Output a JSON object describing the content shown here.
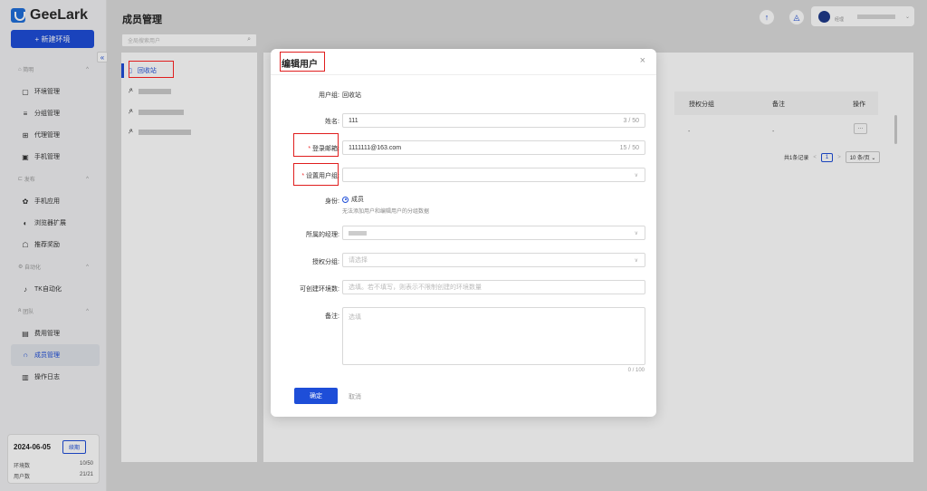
{
  "app": {
    "logo_text": "GeeLark",
    "new_env_label": "+ 新建环境",
    "collapse_label": "«"
  },
  "sidebar": {
    "sections": [
      {
        "label": "简明",
        "items": [
          {
            "label": "环境管理",
            "icon": "▢"
          },
          {
            "label": "分组管理",
            "icon": "≡"
          },
          {
            "label": "代理管理",
            "icon": "⊞"
          },
          {
            "label": "手机管理",
            "icon": "▣"
          }
        ]
      },
      {
        "label": "发布",
        "items": [
          {
            "label": "手机应用",
            "icon": "✿"
          },
          {
            "label": "浏览器扩展",
            "icon": "◐"
          },
          {
            "label": "推荐奖励",
            "icon": "☖"
          }
        ]
      },
      {
        "label": "自动化",
        "items": [
          {
            "label": "TK自动化",
            "icon": "♪"
          }
        ]
      },
      {
        "label": "团队",
        "items": [
          {
            "label": "费用管理",
            "icon": "▤"
          },
          {
            "label": "成员管理",
            "icon": "ဂ"
          },
          {
            "label": "操作日志",
            "icon": "▥"
          }
        ]
      }
    ],
    "bottom": {
      "date": "2024-06-05",
      "renew": "续期",
      "env_label": "环境数",
      "env_value": "10/50",
      "user_label": "用户数",
      "user_value": "21/21"
    }
  },
  "header": {
    "title": "成员管理",
    "user_role": "经理",
    "user_chevron": "⌄"
  },
  "search": {
    "placeholder": "全局搜索用户"
  },
  "groups": {
    "recycle": "回收站"
  },
  "table": {
    "col_perm": "授权分组",
    "col_note": "备注",
    "col_action": "操作",
    "cell_dash1": "-",
    "cell_dash2": "-",
    "more": "···"
  },
  "pagination": {
    "total": "共1条记录",
    "prev": "<",
    "page": "1",
    "next": ">",
    "size": "10 条/页 ⌄"
  },
  "modal": {
    "title": "编辑用户",
    "close": "×",
    "fields": {
      "group_label": "用户组:",
      "group_value": "回收站",
      "name_label": "姓名:",
      "name_value": "111",
      "name_count": "3 / 50",
      "email_label": "登录邮箱:",
      "email_value": "1111111@163.com",
      "email_count": "15 / 50",
      "setgroup_label": "设置用户组:",
      "role_label": "身份:",
      "role_value": "成员",
      "role_hint": "无法添加用户和编辑用户的分组数据",
      "manager_label": "所属的经理:",
      "perm_label": "授权分组:",
      "perm_placeholder": "请选择",
      "envcount_label": "可创建环境数:",
      "envcount_placeholder": "选填。若不填写，则表示不限制创建的环境数量",
      "note_label": "备注:",
      "note_placeholder": "选填",
      "note_count": "0 / 100"
    },
    "ok": "确定",
    "cancel": "取消"
  }
}
